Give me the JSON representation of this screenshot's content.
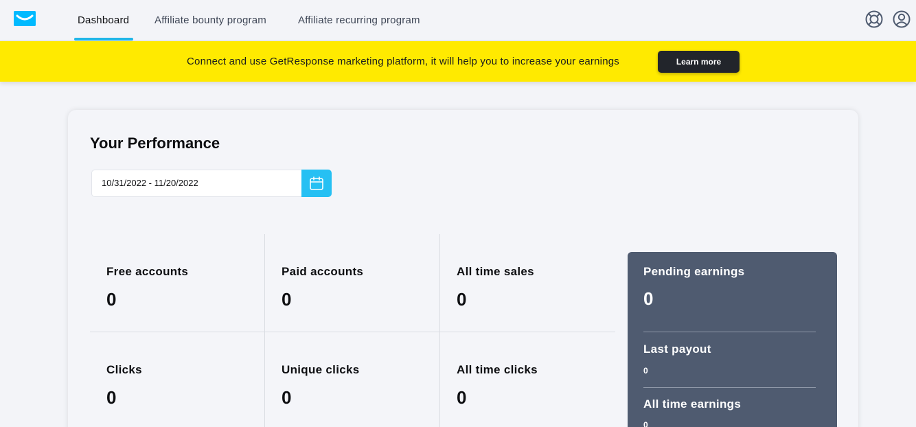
{
  "nav": {
    "tabs": [
      {
        "label": "Dashboard",
        "active": true
      },
      {
        "label": "Affiliate bounty program",
        "active": false
      },
      {
        "label": "Affiliate recurring program",
        "active": false
      }
    ],
    "icons": [
      "help-lifebuoy-icon",
      "user-profile-icon"
    ]
  },
  "banner": {
    "text": "Connect and use GetResponse marketing platform, it will help you to increase your earnings",
    "button_label": "Learn more"
  },
  "performance": {
    "title": "Your Performance",
    "date_range": "10/31/2022 - 11/20/2022",
    "stats": [
      {
        "label": "Free accounts",
        "value": "0"
      },
      {
        "label": "Paid accounts",
        "value": "0"
      },
      {
        "label": "All time sales",
        "value": "0"
      },
      {
        "label": "Clicks",
        "value": "0"
      },
      {
        "label": "Unique clicks",
        "value": "0"
      },
      {
        "label": "All time clicks",
        "value": "0"
      }
    ],
    "earnings": {
      "pending_label": "Pending earnings",
      "pending_value": "0",
      "last_payout_label": "Last payout",
      "last_payout_value": "0",
      "all_time_label": "All time earnings",
      "all_time_value": "0"
    }
  },
  "colors": {
    "accent": "#21b6e8",
    "banner": "#ffea00",
    "earnings_panel": "#4f5b70"
  }
}
